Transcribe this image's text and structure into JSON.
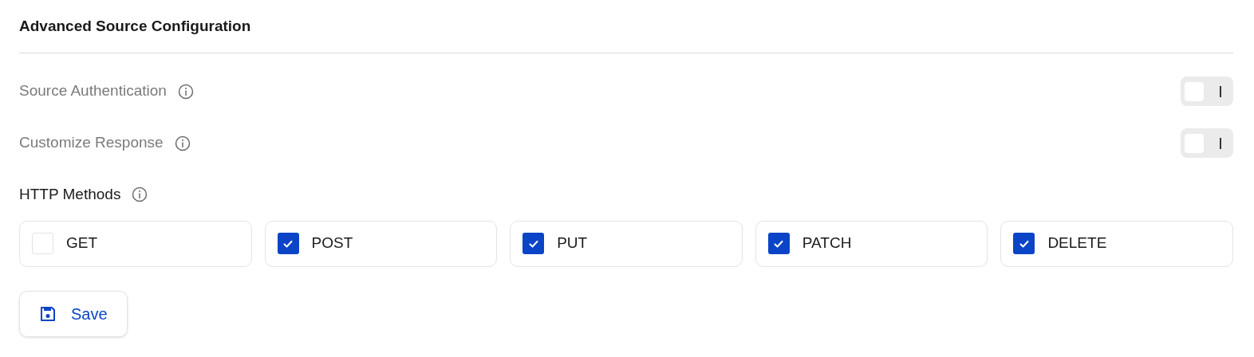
{
  "section": {
    "title": "Advanced Source Configuration"
  },
  "settings": [
    {
      "label": "Source Authentication",
      "on": false
    },
    {
      "label": "Customize Response",
      "on": false
    }
  ],
  "http_methods": {
    "label": "HTTP Methods",
    "options": [
      {
        "label": "GET",
        "checked": false
      },
      {
        "label": "POST",
        "checked": true
      },
      {
        "label": "PUT",
        "checked": true
      },
      {
        "label": "PATCH",
        "checked": true
      },
      {
        "label": "DELETE",
        "checked": true
      }
    ]
  },
  "save_button": {
    "label": "Save"
  }
}
